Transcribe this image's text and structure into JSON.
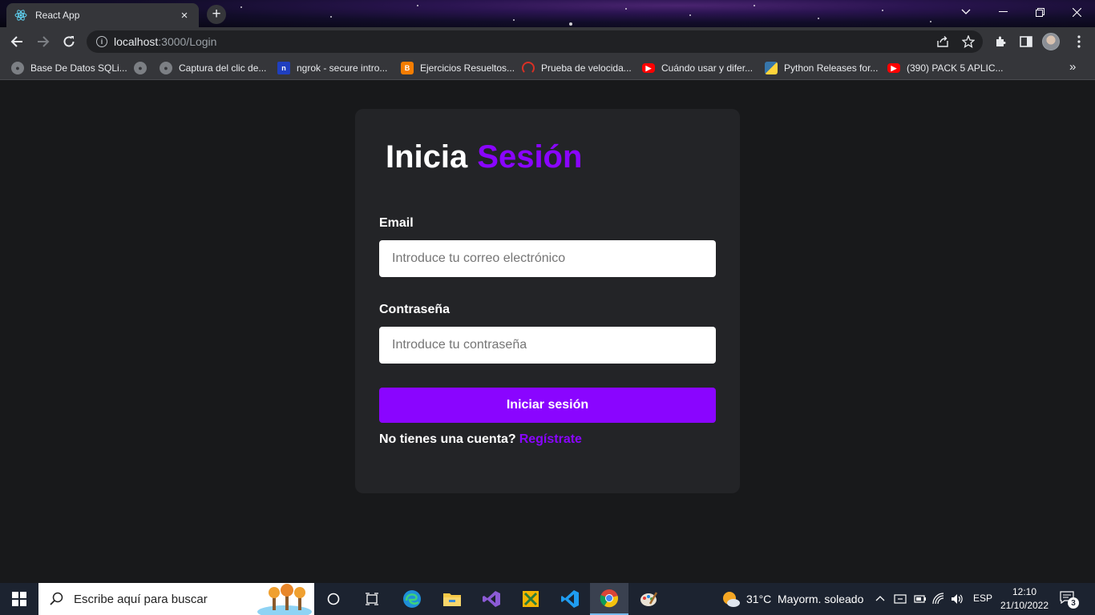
{
  "browser": {
    "tab_title": "React App",
    "tab_close": "×",
    "new_tab": "+",
    "url_host": "localhost",
    "url_path": ":3000/Login",
    "bookmarks": [
      {
        "label": "Base De Datos SQLi...",
        "icon": "globe-icon"
      },
      {
        "label": "",
        "icon": "globe-icon"
      },
      {
        "label": "Captura del clic de...",
        "icon": "globe-icon"
      },
      {
        "label": "ngrok - secure intro...",
        "icon": "ngrok-icon"
      },
      {
        "label": "Ejercicios Resueltos...",
        "icon": "blogger-icon"
      },
      {
        "label": "Prueba de velocida...",
        "icon": "speedtest-icon"
      },
      {
        "label": "Cuándo usar y difer...",
        "icon": "youtube-icon"
      },
      {
        "label": "Python Releases for...",
        "icon": "python-icon"
      },
      {
        "label": "(390) PACK 5 APLIC...",
        "icon": "youtube-icon"
      }
    ],
    "bookmarks_more": "»"
  },
  "login": {
    "title_word1": "Inicia",
    "title_word2": "Sesión",
    "email_label": "Email",
    "email_placeholder": "Introduce tu correo electrónico",
    "password_label": "Contraseña",
    "password_placeholder": "Introduce tu contraseña",
    "submit_label": "Iniciar sesión",
    "signup_prompt": "No tienes una cuenta?",
    "signup_link": "Regístrate",
    "accent_color": "#8a05ff"
  },
  "taskbar": {
    "search_placeholder": "Escribe aquí para buscar",
    "weather_temp": "31°C",
    "weather_desc": "Mayorm. soleado",
    "language": "ESP",
    "time": "12:10",
    "date": "21/10/2022",
    "notifications_count": "3"
  }
}
